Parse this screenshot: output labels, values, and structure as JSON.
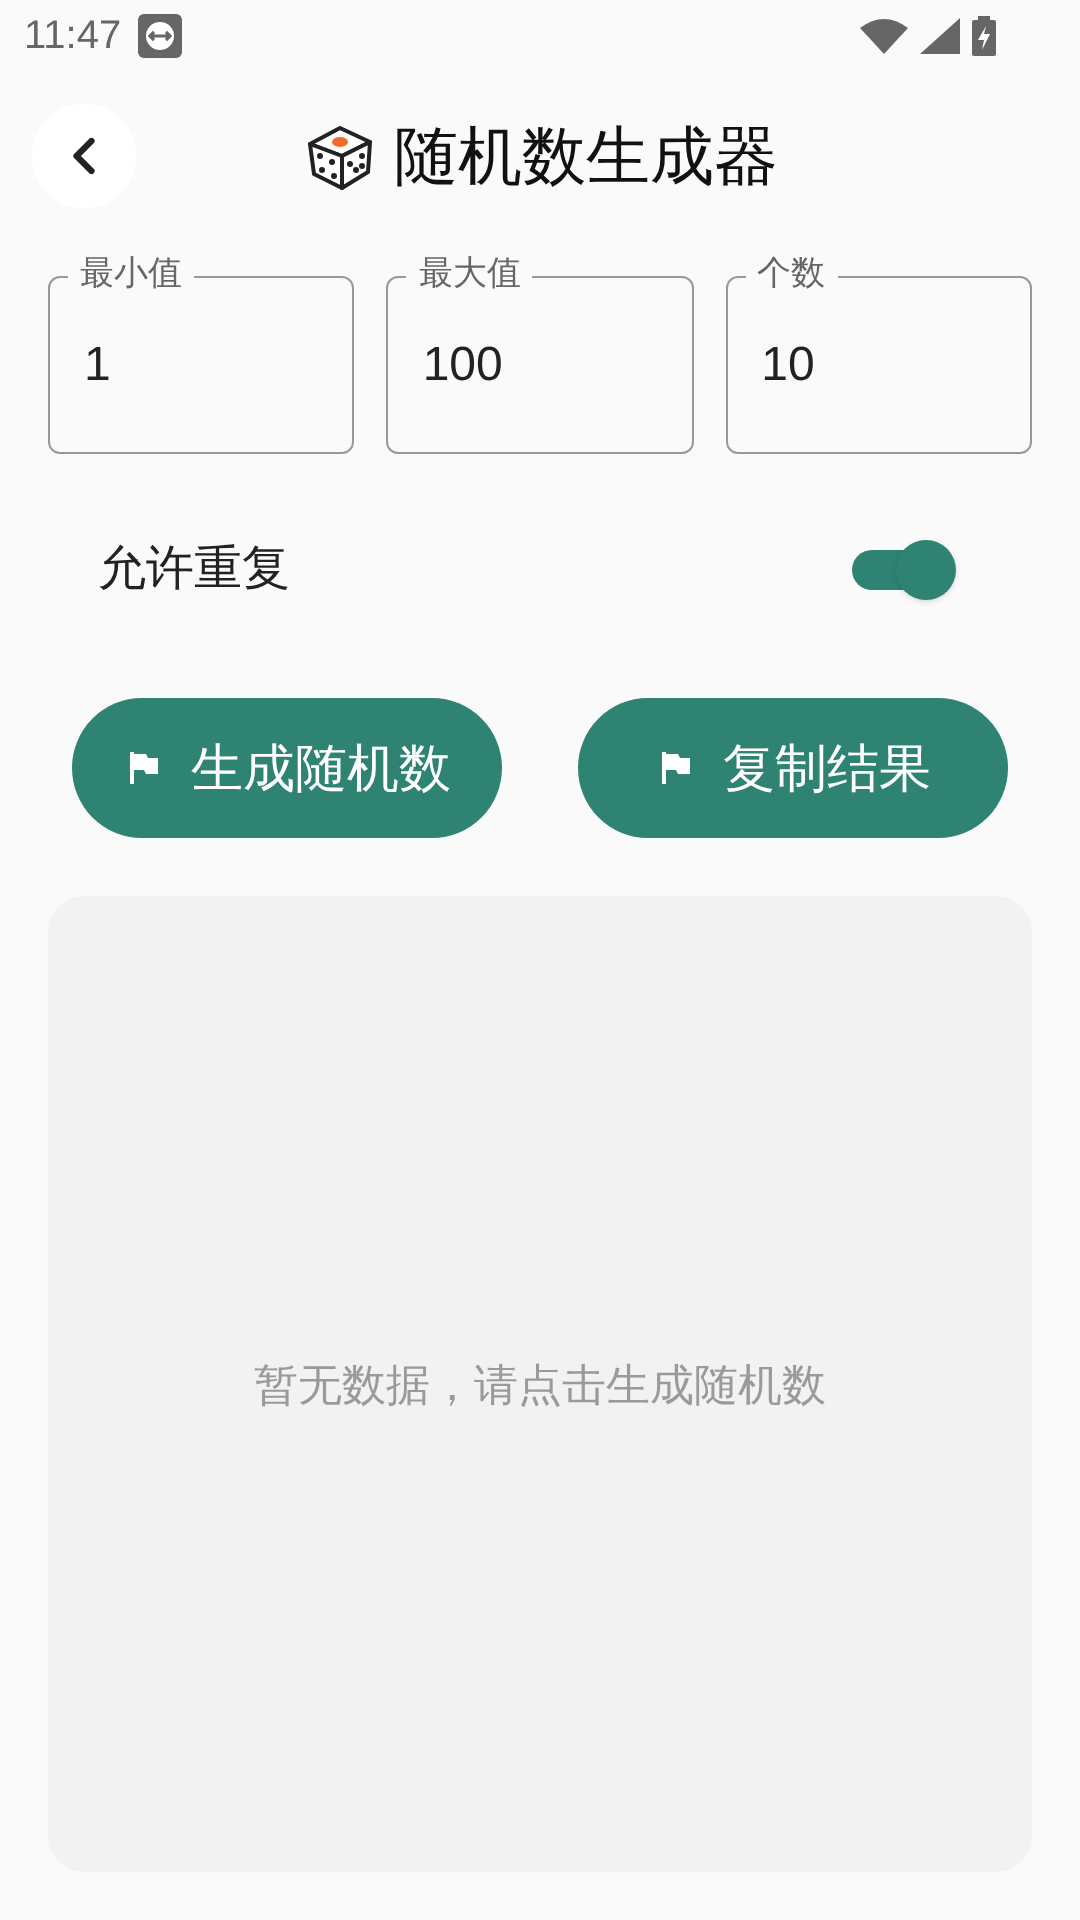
{
  "status_bar": {
    "time": "11:47"
  },
  "header": {
    "title": "随机数生成器"
  },
  "fields": [
    {
      "label": "最小值",
      "value": "1"
    },
    {
      "label": "最大值",
      "value": "100"
    },
    {
      "label": "个数",
      "value": "10"
    }
  ],
  "allow_repeat": {
    "label": "允许重复",
    "on": true
  },
  "buttons": [
    {
      "label": "生成随机数"
    },
    {
      "label": "复制结果"
    }
  ],
  "result": {
    "empty_text": "暂无数据，请点击生成随机数"
  }
}
